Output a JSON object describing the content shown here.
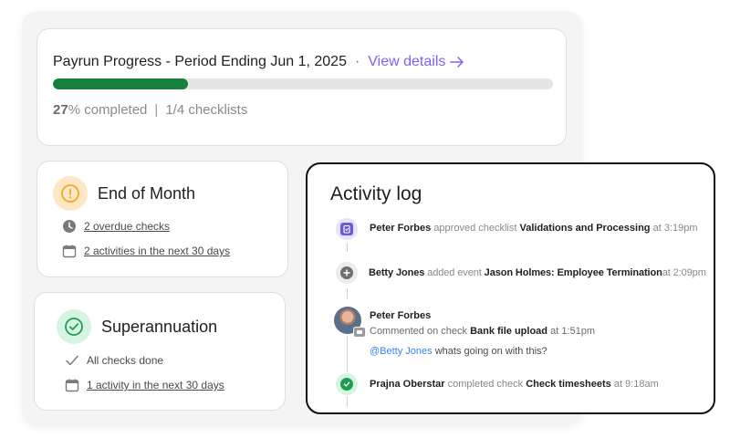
{
  "payrun": {
    "title": "Payrun Progress - Period Ending Jun 1, 2025",
    "separator": "·",
    "view_details": "View details",
    "progress_percent": 27,
    "progress_pct_text": "27",
    "progress_suffix": "% completed",
    "pipe": "|",
    "checklists": "1/4 checklists"
  },
  "end_of_month": {
    "title": "End of Month",
    "overdue": "2 overdue checks",
    "activities": "2 activities in the next 30 days"
  },
  "superannuation": {
    "title": "Superannuation",
    "done": "All checks done",
    "activities": "1 activity in the next 30 days"
  },
  "activity_log": {
    "title": "Activity log",
    "entries": [
      {
        "user": "Peter Forbes",
        "action": "approved checklist",
        "target": "Validations and Processing",
        "time": "at 3:19pm"
      },
      {
        "user": "Betty Jones",
        "action": "added event",
        "target": "Jason Holmes: Employee Termination",
        "time": "at 2:09pm"
      },
      {
        "user": "Peter Forbes",
        "action": "Commented on check",
        "target": "Bank file upload",
        "time": "at 1:51pm",
        "mention": "@Betty Jones",
        "comment": "whats going on with this?"
      },
      {
        "user": "Prajna Oberstar",
        "action": "completed check",
        "target": "Check timesheets",
        "time": "at 9:18am"
      }
    ]
  },
  "colors": {
    "progress_fill": "#17803d",
    "link": "#7b61ff",
    "warning": "#f5a623",
    "success": "#1f9d55",
    "mention": "#3b82f6"
  },
  "icons": [
    "arrow-right-icon",
    "warning-icon",
    "clock-icon",
    "calendar-icon",
    "check-circle-icon",
    "checkmark-icon",
    "checklist-icon",
    "plus-icon",
    "comment-icon"
  ]
}
